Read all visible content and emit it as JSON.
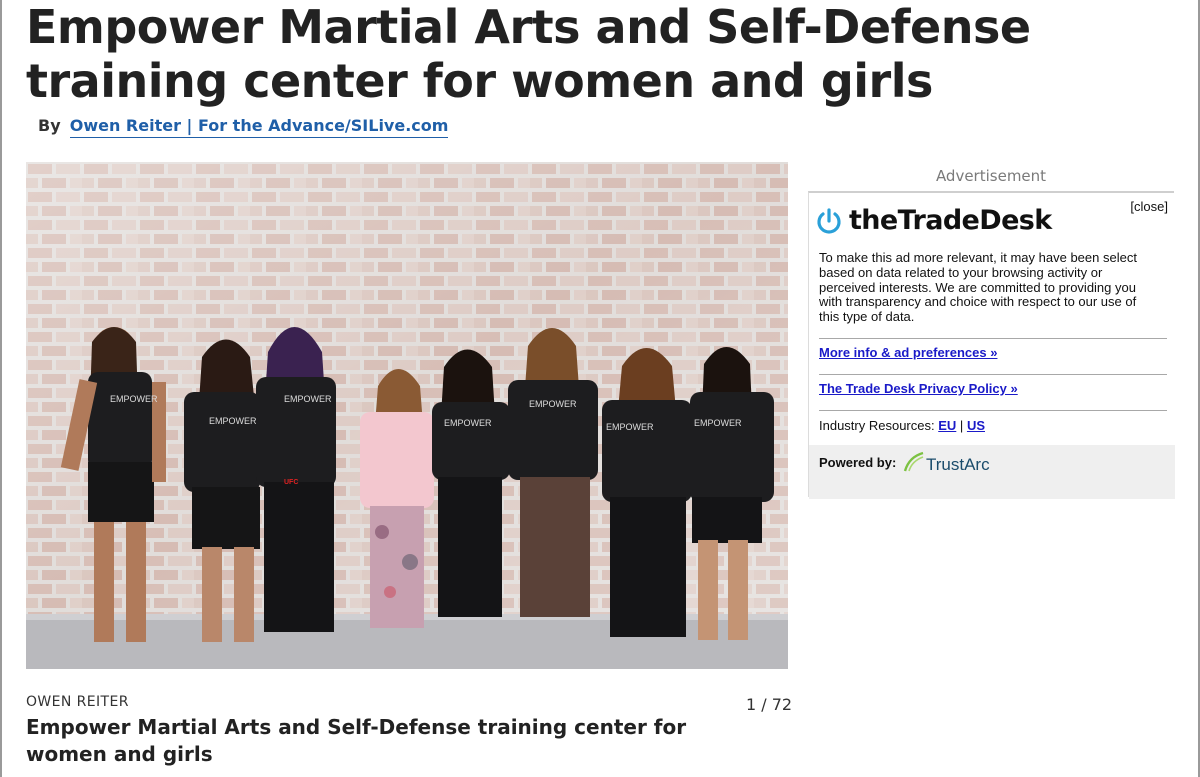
{
  "article": {
    "headline": "Empower Martial Arts and Self-Defense training center for women and girls",
    "byline_prefix": "By",
    "byline_author": "Owen Reiter | For the Advance/SILive.com"
  },
  "gallery": {
    "photo_credit": "OWEN REITER",
    "counter": "1 / 72",
    "caption": "Empower Martial Arts and Self-Defense training center for women and girls",
    "shirt_text": "EMPOWER",
    "shorts_text": "UFC"
  },
  "ad": {
    "label": "Advertisement",
    "close": "[close]",
    "brand": "theTradeDesk",
    "body": "To make this ad more relevant, it may have been select based on data related to your browsing activity or perceived interests. We are committed to providing you with transparency and choice with respect to our use of this type of data.",
    "link_more_info": "More info & ad preferences »",
    "link_privacy": "The Trade Desk Privacy Policy »",
    "resources_label": "Industry Resources:",
    "resources_eu": "EU",
    "resources_sep": "|",
    "resources_us": "US",
    "powered_by": "Powered by:",
    "powered_brand": "TrustArc",
    "colors": {
      "brand_blue": "#2aa0d8",
      "link": "#1a1ac8",
      "author_link": "#1f5fa8"
    }
  }
}
